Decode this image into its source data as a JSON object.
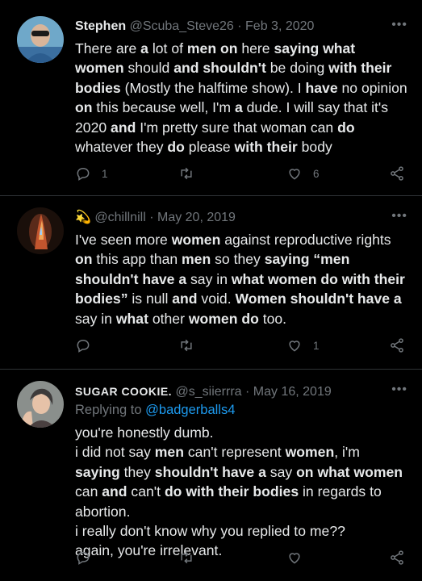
{
  "tweets": [
    {
      "name": "Stephen",
      "handle": "@Scuba_Steve26",
      "date": "Feb 3, 2020",
      "more": "•••",
      "body_segments": [
        [
          "There are ",
          false
        ],
        [
          "a",
          true
        ],
        [
          " lot of ",
          false
        ],
        [
          "men on",
          true
        ],
        [
          " here ",
          false
        ],
        [
          "saying what women",
          true
        ],
        [
          " should ",
          false
        ],
        [
          "and shouldn't",
          true
        ],
        [
          " be doing ",
          false
        ],
        [
          "with their bodies",
          true
        ],
        [
          " (Mostly the halftime show). I ",
          false
        ],
        [
          "have",
          true
        ],
        [
          " no opinion ",
          false
        ],
        [
          "on",
          true
        ],
        [
          " this because well, I'm ",
          false
        ],
        [
          "a",
          true
        ],
        [
          " dude. I will say that it's 2020 ",
          false
        ],
        [
          "and",
          true
        ],
        [
          " I'm pretty sure that woman can ",
          false
        ],
        [
          "do",
          true
        ],
        [
          " whatever they ",
          false
        ],
        [
          "do",
          true
        ],
        [
          " please ",
          false
        ],
        [
          "with their",
          true
        ],
        [
          " body",
          false
        ]
      ],
      "replies": "1",
      "retweets": "",
      "likes": "6"
    },
    {
      "name": "",
      "name_emoji": "💫",
      "handle": "@chillnill",
      "date": "May 20, 2019",
      "more": "•••",
      "body_segments": [
        [
          "I've seen more ",
          false
        ],
        [
          "women",
          true
        ],
        [
          " against reproductive rights ",
          false
        ],
        [
          "on",
          true
        ],
        [
          " this app than ",
          false
        ],
        [
          "men",
          true
        ],
        [
          " so they ",
          false
        ],
        [
          "saying “men shouldn't have a",
          true
        ],
        [
          " say in ",
          false
        ],
        [
          "what women do with their bodies”",
          true
        ],
        [
          " is null ",
          false
        ],
        [
          "and",
          true
        ],
        [
          " void. ",
          false
        ],
        [
          "Women shouldn't have a",
          true
        ],
        [
          " say in ",
          false
        ],
        [
          "what",
          true
        ],
        [
          " other ",
          false
        ],
        [
          "women do",
          true
        ],
        [
          " too.",
          false
        ]
      ],
      "replies": "",
      "retweets": "",
      "likes": "1"
    },
    {
      "name": "SUGAR COOKIE.",
      "handle": "@s_siierrra",
      "date": "May 16, 2019",
      "more": "•••",
      "replying_label": "Replying to",
      "replying_handle": "@badgerballs4",
      "body_segments": [
        [
          "you're honestly dumb.\ni did not say ",
          false
        ],
        [
          "men",
          true
        ],
        [
          " can't represent ",
          false
        ],
        [
          "women",
          true
        ],
        [
          ", i'm ",
          false
        ],
        [
          "saying",
          true
        ],
        [
          " they ",
          false
        ],
        [
          "shouldn't have a",
          true
        ],
        [
          " say ",
          false
        ],
        [
          "on what women",
          true
        ],
        [
          " can ",
          false
        ],
        [
          "and",
          true
        ],
        [
          " can't ",
          false
        ],
        [
          "do with their bodies",
          true
        ],
        [
          " in regards to abortion.\ni really don't know why you replied to me??\nagain, you're irrelevant.",
          false
        ]
      ],
      "replies": "",
      "retweets": "",
      "likes": ""
    }
  ],
  "colors": {
    "background": "#000000",
    "text": "#e7e9ea",
    "secondary": "#71767b",
    "link": "#1d9bf0",
    "divider": "#2f3336"
  },
  "icons": {
    "reply": "reply-icon",
    "retweet": "retweet-icon",
    "like": "heart-icon",
    "share": "share-icon",
    "more": "more-icon"
  }
}
